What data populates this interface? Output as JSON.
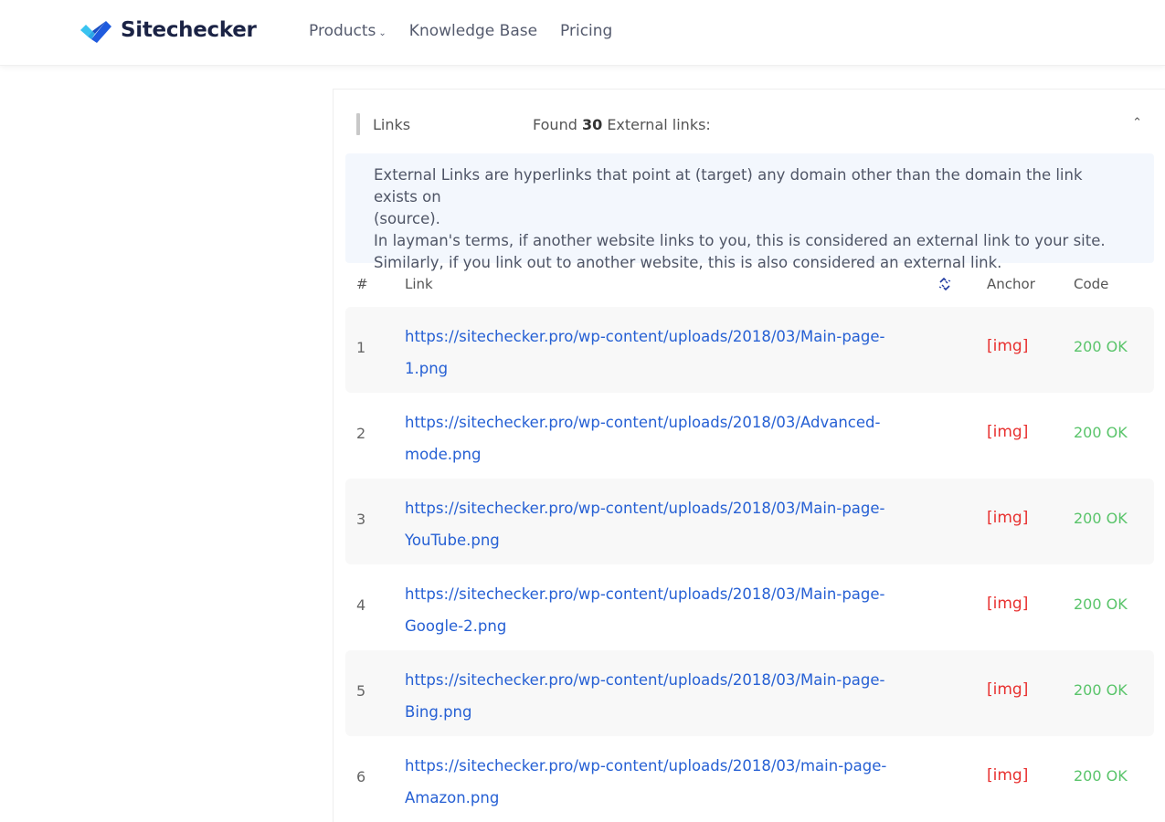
{
  "header": {
    "logo_text": "Sitechecker",
    "brand_colors": {
      "primary": "#1f5bde",
      "secondary": "#39c3f0"
    },
    "nav": [
      {
        "label": "Products",
        "has_dropdown": true
      },
      {
        "label": "Knowledge Base"
      },
      {
        "label": "Pricing"
      }
    ]
  },
  "section": {
    "title": "Links",
    "found_prefix": "Found",
    "found_count": "30",
    "found_suffix": "External links:",
    "description": [
      "External Links are hyperlinks that point at (target) any domain other than the domain the link exists on",
      "(source).",
      "In layman's terms, if another website links to you, this is considered an external link to your site.",
      "Similarly, if you link out to another website, this is also considered an external link."
    ]
  },
  "table": {
    "columns": {
      "num": "#",
      "link": "Link",
      "nofollow_icon": "broken-link-icon",
      "anchor": "Anchor",
      "code": "Code"
    },
    "rows": [
      {
        "num": "1",
        "link_line1": "https://sitechecker.pro/wp-content/uploads/2018/03/Main-page-",
        "link_line2": "1.png",
        "anchor": "[img]",
        "code": "200 OK"
      },
      {
        "num": "2",
        "link_line1": "https://sitechecker.pro/wp-content/uploads/2018/03/Advanced-",
        "link_line2": "mode.png",
        "anchor": "[img]",
        "code": "200 OK"
      },
      {
        "num": "3",
        "link_line1": "https://sitechecker.pro/wp-content/uploads/2018/03/Main-page-",
        "link_line2": "YouTube.png",
        "anchor": "[img]",
        "code": "200 OK"
      },
      {
        "num": "4",
        "link_line1": "https://sitechecker.pro/wp-content/uploads/2018/03/Main-page-",
        "link_line2": "Google-2.png",
        "anchor": "[img]",
        "code": "200 OK"
      },
      {
        "num": "5",
        "link_line1": "https://sitechecker.pro/wp-content/uploads/2018/03/Main-page-",
        "link_line2": "Bing.png",
        "anchor": "[img]",
        "code": "200 OK"
      },
      {
        "num": "6",
        "link_line1": "https://sitechecker.pro/wp-content/uploads/2018/03/main-page-",
        "link_line2": "Amazon.png",
        "anchor": "[img]",
        "code": "200 OK"
      }
    ]
  }
}
